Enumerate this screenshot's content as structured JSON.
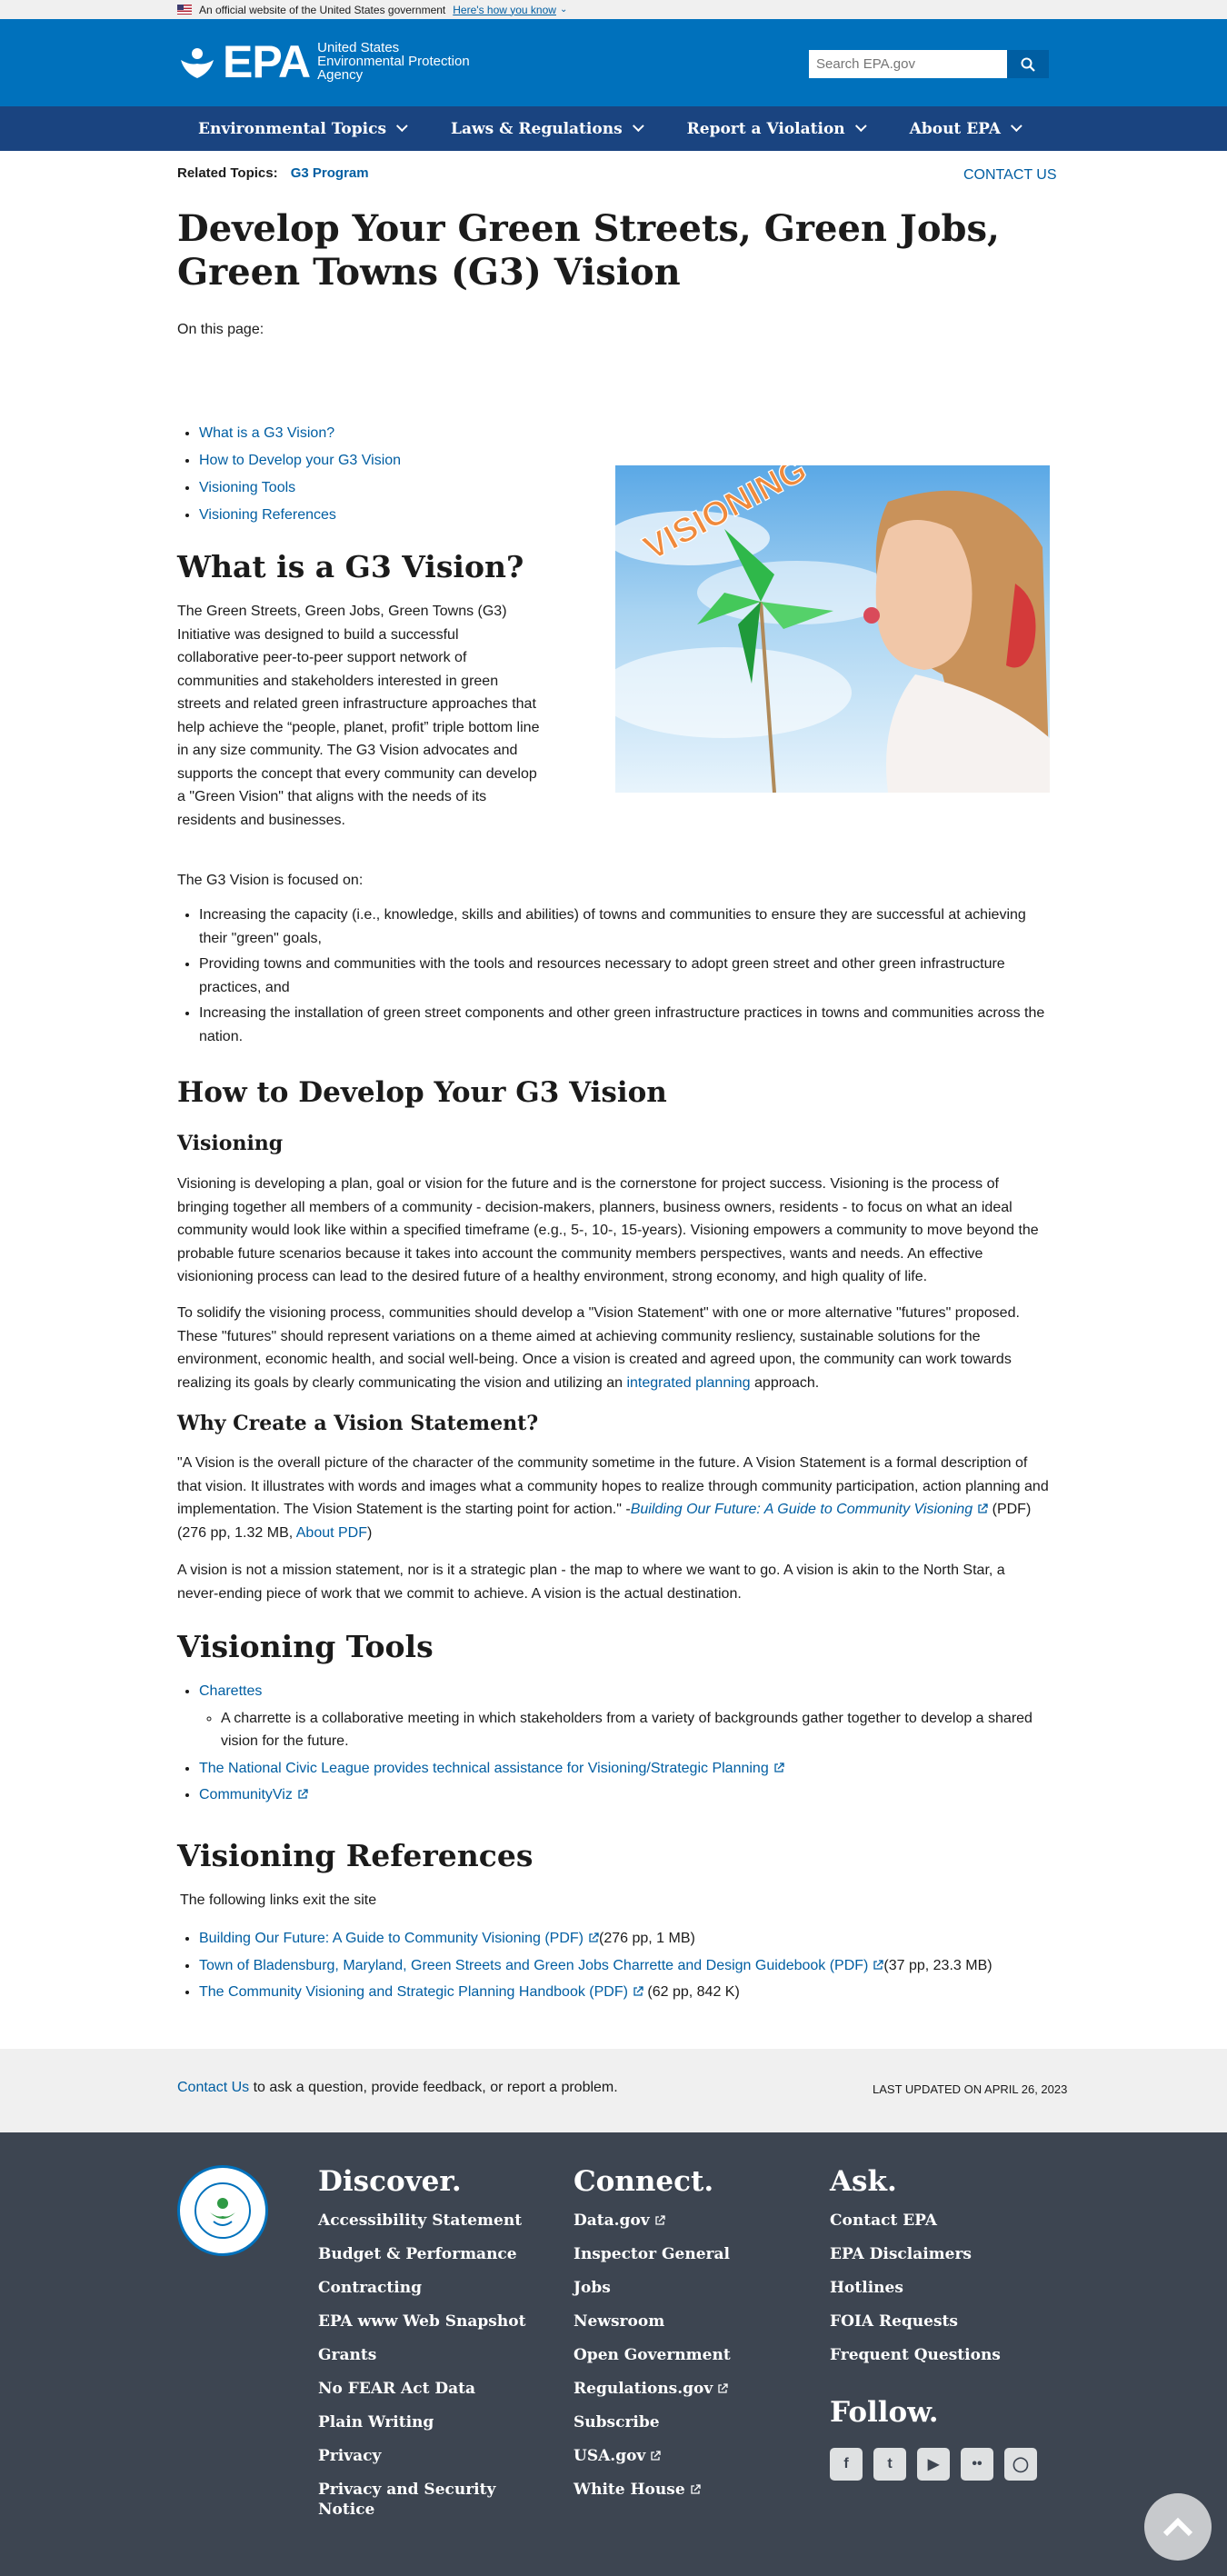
{
  "gov_banner": {
    "text": "An official website of the United States government",
    "link": "Here's how you know"
  },
  "header": {
    "logo_text": "EPA",
    "agency_lines": [
      "United States",
      "Environmental Protection",
      "Agency"
    ],
    "search_placeholder": "Search EPA.gov"
  },
  "nav": [
    "Environmental Topics",
    "Laws & Regulations",
    "Report a Violation",
    "About EPA"
  ],
  "related": {
    "label": "Related Topics:",
    "link": "G3 Program"
  },
  "contact_top": "CONTACT US",
  "page_title": "Develop Your Green Streets, Green Jobs, Green Towns (G3) Vision",
  "on_this_page": "On this page:",
  "toc": [
    "What is a G3 Vision?",
    "How to Develop your G3 Vision",
    "Visioning Tools",
    "Visioning References"
  ],
  "hero_image_text": "VISIONING",
  "what": {
    "heading": "What is a G3 Vision?",
    "paragraph": "The Green Streets, Green Jobs, Green Towns (G3) Initiative was designed to build a successful collaborative peer-to-peer support network of communities and stakeholders interested in green streets and related green infrastructure approaches that help achieve the “people, planet, profit” triple bottom line in any size community.  The G3 Vision advocates and supports the concept that every community can develop a \"Green Vision\" that aligns with the needs of its residents and businesses.",
    "focused": "The G3 Vision is focused on:",
    "focus_items": [
      "Increasing the capacity (i.e., knowledge, skills and abilities) of towns and communities to ensure they are successful at achieving their \"green\" goals,",
      "Providing towns and communities with the tools and resources necessary to adopt green street and other green infrastructure practices, and",
      "Increasing the installation of green street components and other green infrastructure practices in towns and communities across the nation."
    ]
  },
  "how": {
    "heading": "How to Develop Your G3 Vision",
    "visioning_heading": "Visioning",
    "p1": "Visioning is developing a plan, goal or vision for the future and is the cornerstone for project success.  Visioning is the process of bringing together all members of a community - decision-makers, planners, business owners, residents - to focus on what an ideal community would look like within a specified timeframe (e.g., 5-, 10-, 15-years). Visioning empowers a community to move beyond the probable future scenarios because it takes into account the community members perspectives, wants and needs.  An effective visionioning process can lead to the desired future of a healthy environment, strong economy, and high quality of life.",
    "p2_before": "To solidify the visioning process, communities should develop a \"Vision Statement\" with one or more alternative \"futures\" proposed. These \"futures\" should represent variations on a theme aimed at achieving community resliency, sustainable solutions for the environment, economic health, and social well-being. Once a vision is created and agreed upon, the community can work towards realizing its goals by clearly communicating the vision and utilizing an ",
    "p2_link": "integrated planning",
    "p2_after": " approach.",
    "why_heading": "Why Create a Vision Statement?",
    "why_p1_before": "\"A Vision is the overall picture of the character of the community sometime in the future.  A Vision Statement is a formal description of that vision.  It illustrates with words and images what a community hopes to realize through community participation, action planning and implementation. The Vision Statement is the starting point for action.\" -",
    "why_p1_link": "Building Our Future: A Guide to Community Visioning",
    "why_p1_mid": " (PDF)(276 pp, 1.32 MB, ",
    "why_p1_link2": "About PDF",
    "why_p1_after": ")",
    "why_p2": "A vision is not a mission statement, nor is it a strategic plan - the map to where we want to go.  A vision is akin to the North Star, a never-ending piece of work that we commit to achieve.  A vision is the actual destination."
  },
  "tools": {
    "heading": "Visioning Tools",
    "charettes": "Charettes",
    "charette_desc": "A charrette is a collaborative meeting in which stakeholders from a variety of backgrounds gather together to develop a shared vision for the future.",
    "civic": "The National Civic League provides technical assistance for Visioning/Strategic Planning",
    "communityviz": "CommunityViz"
  },
  "refs": {
    "heading": "Visioning References",
    "exit": "The following links exit the site",
    "items": [
      {
        "link": "Building Our Future: A Guide to Community Visioning (PDF)",
        "meta": "(276 pp, 1 MB)"
      },
      {
        "link": "Town of Bladensburg, Maryland, Green Streets and Green Jobs Charrette and Design Guidebook (PDF)",
        "meta": "(37 pp, 23.3 MB)"
      },
      {
        "link": "The Community Visioning and Strategic Planning Handbook (PDF)",
        "meta": " (62 pp, 842 K)"
      }
    ]
  },
  "feedback": {
    "link": "Contact Us",
    "text": " to ask a question, provide feedback, or report a problem.",
    "updated": "LAST UPDATED ON APRIL 26, 2023"
  },
  "footer": {
    "discover": {
      "heading": "Discover.",
      "items": [
        "Accessibility Statement",
        "Budget & Performance",
        "Contracting",
        "EPA www Web Snapshot",
        "Grants",
        "No FEAR Act Data",
        "Plain Writing",
        "Privacy",
        "Privacy and Security Notice"
      ]
    },
    "connect": {
      "heading": "Connect.",
      "items": [
        "Data.gov",
        "Inspector General",
        "Jobs",
        "Newsroom",
        "Open Government",
        "Regulations.gov",
        "Subscribe",
        "USA.gov",
        "White House"
      ]
    },
    "ask": {
      "heading": "Ask.",
      "items": [
        "Contact EPA",
        "EPA Disclaimers",
        "Hotlines",
        "FOIA Requests",
        "Frequent Questions"
      ]
    },
    "follow": "Follow.",
    "social": [
      "facebook-icon",
      "twitter-icon",
      "youtube-icon",
      "flickr-icon",
      "instagram-icon"
    ]
  },
  "colors": {
    "header": "#0071bc",
    "nav": "#1a4480",
    "footer": "#3d4551",
    "link": "#005ea2"
  }
}
